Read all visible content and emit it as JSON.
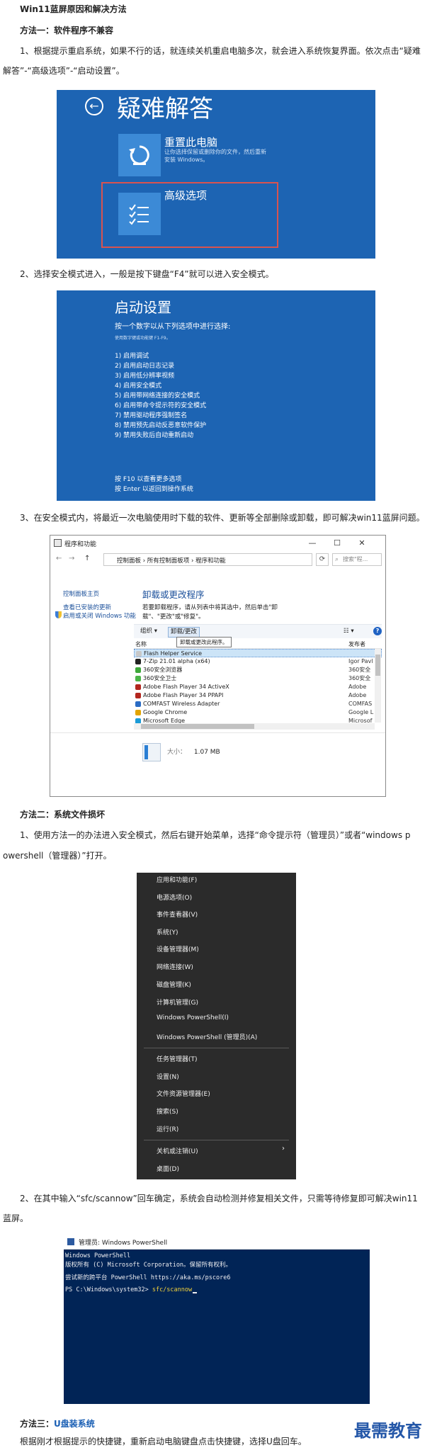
{
  "doc": {
    "heading": "Win11蓝屏原因和解决方法",
    "m1_title": "方法一：软件程序不兼容",
    "p1_line1": "1、根据提示重启系统，如果不行的话，就连续关机重启电脑多次，就会进入系统恢复界面。依次点击“疑难",
    "p1_line2": "解答”-“高级选项”-“启动设置”。",
    "p2": "2、选择安全模式进入，一般是按下键盘“F4”就可以进入安全模式。",
    "p3": "3、在安全模式内，将最近一次电脑使用时下载的软件、更新等全部删除或卸载，即可解决win11蓝屏问题。",
    "m2_title": "方法二：系统文件损坏",
    "p4_line1": "1、使用方法一的办法进入安全模式，然后右键开始菜单，选择“命令提示符（管理员）”或者“windows p",
    "p4_line2": "owershell（管理器）”打开。",
    "p5_line1": "2、在其中输入“sfc/scannow”回车确定，系统会自动检测并修复相关文件，只需等待修复即可解决win11",
    "p5_line2": "蓝屏。",
    "m3_prefix": "方法三：",
    "m3_link": "U盘装系统",
    "p6": "根据刚才根据提示的快捷键，重新启动电脑键盘点击快捷键，选择U盘回车。",
    "watermark": "最需教育"
  },
  "troubleshoot": {
    "title": "疑难解答",
    "back_glyph": "←",
    "reset_title": "重置此电脑",
    "reset_desc": "让你选择保留或删除你的文件，然后重新安装 Windows。",
    "advanced_title": "高级选项"
  },
  "startup": {
    "title": "启动设置",
    "subtitle": "按一个数字以从下列选项中进行选择:",
    "tiny": "使用数字键或功能键 F1-F9。",
    "options": [
      "1) 启用调试",
      "2) 启用启动日志记录",
      "3) 启用低分辨率视频",
      "4) 启用安全模式",
      "5) 启用带网络连接的安全模式",
      "6) 启用带命令提示符的安全模式",
      "7) 禁用驱动程序强制签名",
      "8) 禁用预先启动反恶意软件保护",
      "9) 禁用失败后自动重新启动"
    ],
    "footer1": "按 F10 以查看更多选项",
    "footer2": "按 Enter 以返回到操作系统"
  },
  "programs": {
    "window_title": "程序和功能",
    "minimize": "—",
    "maximize": "☐",
    "close": "✕",
    "nav_back": "←",
    "nav_fwd": "→",
    "nav_up": "↑",
    "breadcrumb": "控制面板  ›  所有控制面板项  ›  程序和功能",
    "search_placeholder": "搜索\"程...",
    "left_home": "控制面板主页",
    "left_updates": "查看已安装的更新",
    "left_features": "启用或关闭 Windows 功能",
    "main_title": "卸载或更改程序",
    "main_desc": "若要卸载程序，请从列表中将其选中，然后单击\"卸载\"、\"更改\"或\"修复\"。",
    "organize": "组织 ▾",
    "uninstall": "卸载/更改",
    "view": "☷ ▾",
    "help": "?",
    "tooltip": "卸载或更改此程序。",
    "col_name": "名称",
    "col_publisher": "发布者",
    "rows": [
      {
        "name": "Flash Helper Service",
        "publisher": "",
        "color": "#c8c8c8"
      },
      {
        "name": "7-Zip 21.01 alpha (x64)",
        "publisher": "Igor Pavl",
        "color": "#222222"
      },
      {
        "name": "360安全浏览器",
        "publisher": "360安全",
        "color": "#3ea83a"
      },
      {
        "name": "360安全卫士",
        "publisher": "360安全",
        "color": "#4bb548"
      },
      {
        "name": "Adobe Flash Player 34 ActiveX",
        "publisher": "Adobe",
        "color": "#b3261e"
      },
      {
        "name": "Adobe Flash Player 34 PPAPI",
        "publisher": "Adobe",
        "color": "#b3261e"
      },
      {
        "name": "COMFAST Wireless Adapter",
        "publisher": "COMFAS",
        "color": "#2b6cc4"
      },
      {
        "name": "Google Chrome",
        "publisher": "Google L",
        "color": "#e2a400"
      },
      {
        "name": "Microsoft Edge",
        "publisher": "Microsof",
        "color": "#1a9bd7"
      }
    ],
    "size_label": "大小：",
    "size_value": "1.07 MB"
  },
  "context_menu": {
    "items": [
      "应用和功能(F)",
      "电源选项(O)",
      "事件查看器(V)",
      "系统(Y)",
      "设备管理器(M)",
      "网络连接(W)",
      "磁盘管理(K)",
      "计算机管理(G)",
      "Windows PowerShell(I)",
      "Windows PowerShell (管理员)(A)",
      "任务管理器(T)",
      "设置(N)",
      "文件资源管理器(E)",
      "搜索(S)",
      "运行(R)",
      "关机或注销(U)",
      "桌面(D)"
    ],
    "submenu_arrow": "›"
  },
  "powershell": {
    "window_title": "管理员: Windows PowerShell",
    "line1": "Windows PowerShell",
    "line2": "版权所有 (C) Microsoft Corporation。保留所有权利。",
    "line3": "尝试新的跨平台 PowerShell https://aka.ms/pscore6",
    "prompt": "PS C:\\Windows\\system32> ",
    "command": "sfc/scannow"
  }
}
